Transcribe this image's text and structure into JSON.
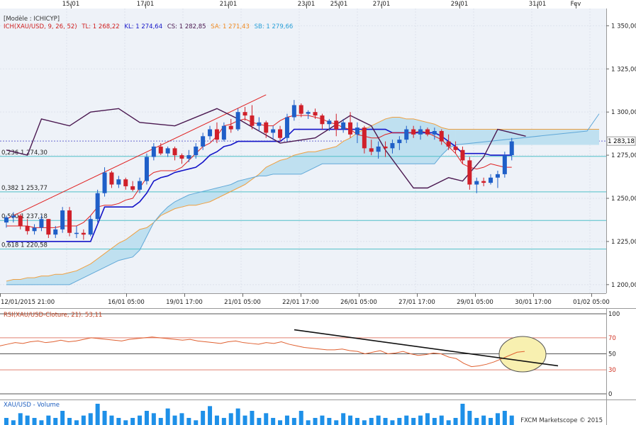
{
  "chart_data": {
    "type": "candlestick",
    "colors": {
      "up": "#1f5fc8",
      "down": "#d0202a",
      "tenkan": "#e02020",
      "kijun": "#1414c8",
      "chikou": "#4a1850",
      "ssa": "#f0a040",
      "cloud": "#bfe0f0",
      "fibo": "#50c0c8",
      "rsi": "#e06030",
      "trend": "#e02020",
      "volume": "#1e90e8",
      "plot_bg": "#eef2f8",
      "highlight": "#f8f0b0"
    },
    "top_dates": [
      "15/01",
      "17/01",
      "21/01",
      "23/01",
      "25/01",
      "27/01",
      "29/01",
      "31/01",
      "Fev"
    ],
    "bottom_dates": [
      "12/01/2015 21:00",
      "16/01 05:00",
      "19/01 17:00",
      "21/01 05:00",
      "22/01 17:00",
      "26/01 05:00",
      "27/01 17:00",
      "29/01 05:00",
      "30/01 17:00",
      "01/02 05:00"
    ],
    "price_ticks": [
      "1 350,00",
      "1 325,00",
      "1 300,00",
      "1 275,00",
      "1 250,00",
      "1 225,00",
      "1 200,00"
    ],
    "price_tick_values": [
      1350,
      1325,
      1300,
      1275,
      1250,
      1225,
      1200
    ],
    "ylim": [
      1195,
      1360
    ],
    "last_price": "1 283,18",
    "last_price_value": 1283.18,
    "legend_model": "[Modèle : ICHICYP]",
    "legend_ich": "ICH(XAU/USD, 9, 26, 52)",
    "legend_tl": "TL: 1 268,22",
    "legend_kl": "KL: 1 274,64",
    "legend_cs": "CS: 1 282,85",
    "legend_sa": "SA: 1 271,43",
    "legend_sb": "SB: 1 279,66",
    "fibo_levels": [
      {
        "label": "0,236 1 274,30",
        "value": 1274.3
      },
      {
        "label": "0,382 1 253,77",
        "value": 1253.77
      },
      {
        "label": "0,500 1 237,18",
        "value": 1237.18
      },
      {
        "label": "0,618 1 220,58",
        "value": 1220.58
      }
    ],
    "candles": [
      [
        1236,
        1240,
        1233,
        1239
      ],
      [
        1239,
        1242,
        1236,
        1240
      ],
      [
        1240,
        1241,
        1232,
        1234
      ],
      [
        1234,
        1238,
        1229,
        1231
      ],
      [
        1231,
        1235,
        1229,
        1233
      ],
      [
        1233,
        1240,
        1231,
        1238
      ],
      [
        1238,
        1238,
        1227,
        1229
      ],
      [
        1229,
        1234,
        1227,
        1232
      ],
      [
        1232,
        1245,
        1230,
        1243
      ],
      [
        1243,
        1245,
        1228,
        1230
      ],
      [
        1230,
        1234,
        1227,
        1230
      ],
      [
        1230,
        1232,
        1226,
        1229
      ],
      [
        1229,
        1240,
        1228,
        1238
      ],
      [
        1238,
        1255,
        1236,
        1253
      ],
      [
        1253,
        1268,
        1251,
        1265
      ],
      [
        1265,
        1266,
        1256,
        1258
      ],
      [
        1258,
        1263,
        1256,
        1261
      ],
      [
        1261,
        1262,
        1255,
        1257
      ],
      [
        1257,
        1260,
        1254,
        1255
      ],
      [
        1255,
        1262,
        1253,
        1260
      ],
      [
        1260,
        1276,
        1258,
        1274
      ],
      [
        1274,
        1282,
        1272,
        1280
      ],
      [
        1280,
        1282,
        1275,
        1276
      ],
      [
        1276,
        1280,
        1274,
        1279
      ],
      [
        1279,
        1280,
        1272,
        1275
      ],
      [
        1275,
        1276,
        1270,
        1273
      ],
      [
        1273,
        1278,
        1271,
        1275
      ],
      [
        1275,
        1282,
        1273,
        1280
      ],
      [
        1280,
        1288,
        1278,
        1286
      ],
      [
        1286,
        1292,
        1284,
        1290
      ],
      [
        1290,
        1294,
        1282,
        1284
      ],
      [
        1284,
        1294,
        1283,
        1292
      ],
      [
        1292,
        1296,
        1288,
        1290
      ],
      [
        1290,
        1302,
        1289,
        1300
      ],
      [
        1300,
        1303,
        1295,
        1298
      ],
      [
        1298,
        1304,
        1290,
        1292
      ],
      [
        1292,
        1297,
        1289,
        1294
      ],
      [
        1294,
        1295,
        1285,
        1288
      ],
      [
        1288,
        1292,
        1284,
        1290
      ],
      [
        1290,
        1292,
        1283,
        1285
      ],
      [
        1285,
        1299,
        1283,
        1297
      ],
      [
        1297,
        1307,
        1295,
        1304
      ],
      [
        1304,
        1305,
        1297,
        1299
      ],
      [
        1299,
        1301,
        1296,
        1300
      ],
      [
        1300,
        1302,
        1296,
        1298
      ],
      [
        1298,
        1299,
        1290,
        1293
      ],
      [
        1293,
        1296,
        1289,
        1295
      ],
      [
        1295,
        1299,
        1286,
        1290
      ],
      [
        1290,
        1296,
        1288,
        1294
      ],
      [
        1294,
        1300,
        1285,
        1287
      ],
      [
        1287,
        1294,
        1282,
        1291
      ],
      [
        1291,
        1292,
        1276,
        1279
      ],
      [
        1279,
        1284,
        1275,
        1277
      ],
      [
        1277,
        1283,
        1273,
        1280
      ],
      [
        1280,
        1283,
        1274,
        1279
      ],
      [
        1279,
        1284,
        1276,
        1282
      ],
      [
        1282,
        1286,
        1278,
        1284
      ],
      [
        1284,
        1292,
        1282,
        1290
      ],
      [
        1290,
        1292,
        1285,
        1287
      ],
      [
        1287,
        1292,
        1284,
        1290
      ],
      [
        1290,
        1291,
        1286,
        1287
      ],
      [
        1287,
        1291,
        1284,
        1289
      ],
      [
        1289,
        1290,
        1281,
        1283
      ],
      [
        1283,
        1287,
        1278,
        1280
      ],
      [
        1280,
        1283,
        1276,
        1278
      ],
      [
        1278,
        1280,
        1270,
        1272
      ],
      [
        1272,
        1274,
        1255,
        1258
      ],
      [
        1258,
        1262,
        1253,
        1260
      ],
      [
        1260,
        1262,
        1257,
        1259
      ],
      [
        1259,
        1264,
        1258,
        1262
      ],
      [
        1262,
        1266,
        1256,
        1264
      ],
      [
        1264,
        1277,
        1262,
        1275
      ],
      [
        1275,
        1285,
        1272,
        1283
      ]
    ],
    "tenkan": [
      1234,
      1234,
      1234,
      1234,
      1233,
      1233,
      1233,
      1233,
      1234,
      1234,
      1234,
      1236,
      1240,
      1245,
      1246,
      1246,
      1247,
      1249,
      1250,
      1256,
      1262,
      1265,
      1266,
      1266,
      1266,
      1268,
      1272,
      1276,
      1280,
      1282,
      1286,
      1292,
      1293,
      1295,
      1296,
      1294,
      1293,
      1292,
      1292,
      1295,
      1297,
      1298,
      1298,
      1298,
      1297,
      1296,
      1294,
      1293,
      1291,
      1290,
      1287,
      1286,
      1285,
      1285,
      1287,
      1288,
      1288,
      1288,
      1288,
      1289,
      1288,
      1286,
      1284,
      1280,
      1276,
      1270,
      1268,
      1267,
      1268,
      1270,
      1269,
      1268,
      1268
    ],
    "kijun": [
      1225,
      1225,
      1225,
      1225,
      1225,
      1225,
      1225,
      1225,
      1225,
      1225,
      1225,
      1225,
      1225,
      1235,
      1245,
      1245,
      1245,
      1245,
      1245,
      1248,
      1253,
      1260,
      1262,
      1263,
      1265,
      1266,
      1267,
      1268,
      1271,
      1275,
      1277,
      1280,
      1281,
      1283,
      1283,
      1283,
      1283,
      1283,
      1283,
      1283,
      1286,
      1290,
      1290,
      1290,
      1290,
      1290,
      1290,
      1290,
      1290,
      1290,
      1290,
      1290,
      1290,
      1290,
      1290,
      1288,
      1288,
      1288,
      1288,
      1288,
      1288,
      1288,
      1286,
      1283,
      1280,
      1276,
      1276,
      1276,
      1276,
      1275,
      1275,
      1275,
      1275
    ],
    "chikou": [
      [
        0,
        1278
      ],
      [
        3,
        1275
      ],
      [
        5,
        1296
      ],
      [
        9,
        1292
      ],
      [
        12,
        1300
      ],
      [
        16,
        1302
      ],
      [
        19,
        1294
      ],
      [
        24,
        1292
      ],
      [
        30,
        1302
      ],
      [
        33,
        1296
      ],
      [
        39,
        1282
      ],
      [
        44,
        1285
      ],
      [
        49,
        1298
      ],
      [
        52,
        1292
      ],
      [
        54,
        1278
      ],
      [
        58,
        1256
      ],
      [
        60,
        1256
      ],
      [
        63,
        1262
      ],
      [
        65,
        1260
      ],
      [
        68,
        1274
      ],
      [
        70,
        1290
      ],
      [
        72,
        1288
      ],
      [
        74,
        1286
      ]
    ],
    "ssa": [
      1202,
      1203,
      1203,
      1204,
      1204,
      1205,
      1205,
      1206,
      1206,
      1207,
      1208,
      1210,
      1212,
      1215,
      1218,
      1221,
      1224,
      1226,
      1229,
      1232,
      1233,
      1236,
      1240,
      1242,
      1244,
      1245,
      1246,
      1246,
      1247,
      1248,
      1250,
      1252,
      1254,
      1256,
      1258,
      1261,
      1264,
      1268,
      1270,
      1272,
      1273,
      1275,
      1276,
      1277,
      1277,
      1278,
      1279,
      1280,
      1283,
      1285,
      1288,
      1290,
      1292,
      1294,
      1296,
      1297,
      1297,
      1296,
      1296,
      1295,
      1294,
      1293,
      1291,
      1290,
      1290
    ],
    "ssb": [
      1200,
      1200,
      1200,
      1200,
      1200,
      1200,
      1200,
      1200,
      1200,
      1200,
      1202,
      1204,
      1206,
      1208,
      1210,
      1212,
      1214,
      1215,
      1216,
      1220,
      1228,
      1236,
      1241,
      1245,
      1248,
      1250,
      1252,
      1253,
      1254,
      1255,
      1256,
      1257,
      1258,
      1260,
      1261,
      1262,
      1263,
      1263,
      1264,
      1264,
      1264,
      1264,
      1264,
      1266,
      1268,
      1270,
      1270,
      1270,
      1270,
      1270,
      1270,
      1270,
      1270,
      1270,
      1270,
      1270,
      1270,
      1270,
      1270,
      1270,
      1270,
      1270,
      1275,
      1279,
      1281
    ],
    "rsi_label": "RSI(XAU/USD-Cloture, 21): 53,11",
    "rsi_ticks": [
      "100",
      "70",
      "50",
      "30",
      "0"
    ],
    "rsi_tick_values": [
      100,
      70,
      50,
      30,
      0
    ],
    "rsi": [
      60,
      62,
      64,
      63,
      65,
      66,
      64,
      65,
      67,
      65,
      66,
      68,
      70,
      69,
      68,
      67,
      66,
      68,
      69,
      70,
      71,
      70,
      69,
      68,
      67,
      68,
      66,
      65,
      64,
      63,
      65,
      66,
      64,
      63,
      62,
      64,
      63,
      65,
      62,
      60,
      58,
      57,
      56,
      55,
      55,
      56,
      54,
      53,
      50,
      52,
      54,
      50,
      51,
      53,
      50,
      48,
      49,
      51,
      50,
      46,
      44,
      38,
      34,
      35,
      37,
      40,
      44,
      48,
      52,
      53
    ],
    "rsi_trend": [
      [
        0.48,
        80
      ],
      [
        0.92,
        35
      ]
    ],
    "volume_label": "XAU/USD - Volume",
    "volume": [
      3,
      2,
      5,
      4,
      3,
      2,
      4,
      3,
      6,
      3,
      2,
      4,
      5,
      9,
      6,
      4,
      3,
      2,
      3,
      4,
      6,
      5,
      3,
      7,
      4,
      5,
      3,
      2,
      6,
      8,
      4,
      3,
      5,
      7,
      4,
      6,
      3,
      5,
      3,
      2,
      4,
      3,
      6,
      2,
      3,
      4,
      3,
      2,
      5,
      4,
      3,
      2,
      3,
      4,
      3,
      2,
      3,
      4,
      3,
      4,
      5,
      3,
      4,
      2,
      3,
      9,
      6,
      3,
      4,
      3,
      5,
      6,
      4
    ],
    "copyright": "FXCM Marketscope © 2015"
  }
}
